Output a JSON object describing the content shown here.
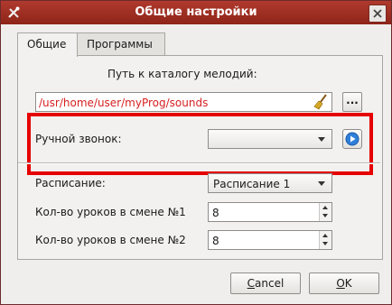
{
  "window": {
    "title": "Общие настройки",
    "icons": {
      "app": "tools-icon",
      "close": "close-icon"
    }
  },
  "tabs": [
    {
      "label": "Общие",
      "active": true
    },
    {
      "label": "Программы",
      "active": false
    }
  ],
  "melodies": {
    "label": "Путь к каталогу мелодий:",
    "path_value": "/usr/home/user/myProg/sounds",
    "browse_label": "..."
  },
  "manual_bell": {
    "label": "Ручной звонок:",
    "selected": "",
    "play_icon": "play-icon"
  },
  "schedule": {
    "label": "Расписание:",
    "selected": "Расписание 1"
  },
  "shift1": {
    "label": "Кол-во уроков в смене №1",
    "value": "8"
  },
  "shift2": {
    "label": "Кол-во уроков в смене №2",
    "value": "8"
  },
  "buttons": {
    "cancel_first": "C",
    "cancel_rest": "ancel",
    "ok_first": "O",
    "ok_rest": "K"
  },
  "colors": {
    "titlebar": "#9e2d22",
    "path_text": "#d62020",
    "highlight": "#e60000"
  }
}
